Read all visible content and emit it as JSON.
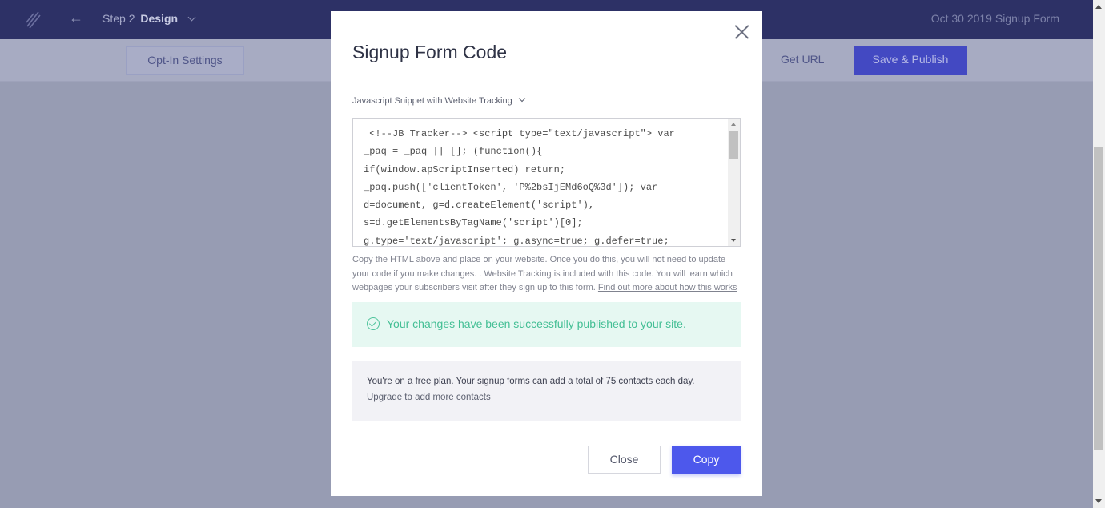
{
  "header": {
    "logo_icon": "brand-logo-icon",
    "back_icon": "arrow-left-icon",
    "step_label": "Step 2",
    "step_name": "Design",
    "form_title": "Oct 30 2019 Signup Form"
  },
  "toolbar": {
    "optin_settings_label": "Opt-In Settings",
    "get_url_label": "Get URL",
    "save_publish_label": "Save & Publish"
  },
  "modal": {
    "title": "Signup Form Code",
    "snippet_type": "Javascript Snippet with Website Tracking",
    "code_lines": [
      " <!--JB Tracker--> <script type=\"text/javascript\"> var",
      "_paq = _paq || []; (function(){",
      "if(window.apScriptInserted) return;",
      "_paq.push(['clientToken', 'P%2bsIjEMd6oQ%3d']); var",
      "d=document, g=d.createElement('script'),",
      "s=d.getElementsByTagName('script')[0];",
      "g.type='text/javascript'; g.async=true; g.defer=true;"
    ],
    "help_text": "Copy the HTML above and place on your website. Once you do this, you will not need to update your code if you make changes. . Website Tracking is included with this code. You will learn which webpages your subscribers visit after they sign up to this form. ",
    "help_link": "Find out more about how this works",
    "success_message": "Your changes have been successfully published to your site.",
    "plan_text": "You're on a free plan. Your signup forms can add a total of 75 contacts each day.",
    "upgrade_link": "Upgrade to add more contacts",
    "close_label": "Close",
    "copy_label": "Copy"
  },
  "colors": {
    "topbar": "#2d3166",
    "accent": "#4d58ec",
    "success": "#44bf95",
    "success_bg": "#e6f8f2"
  }
}
